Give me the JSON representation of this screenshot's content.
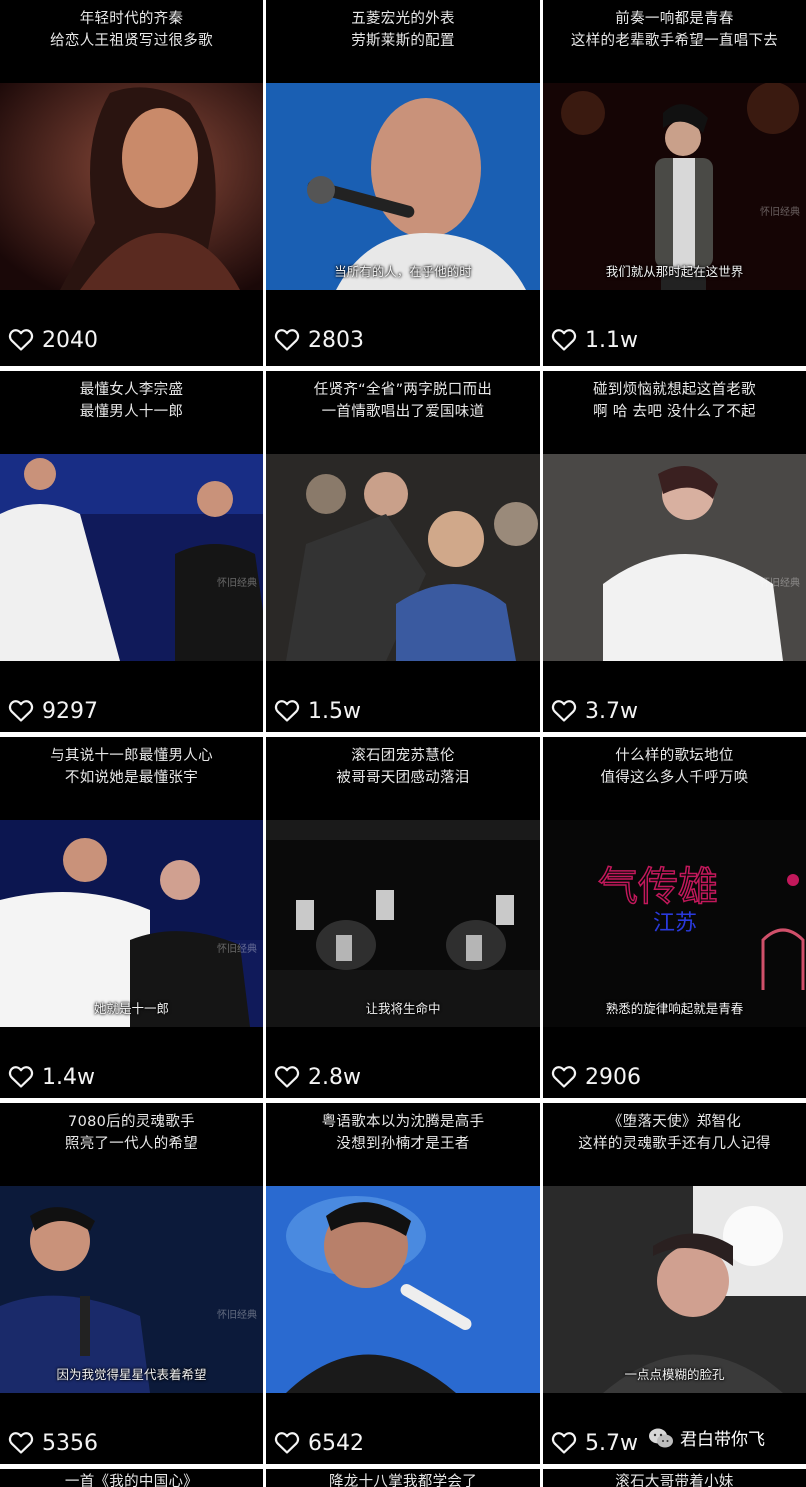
{
  "colors": {
    "cell_bg": "#000000",
    "gap": "#ffffff",
    "text": "#e8e8e8"
  },
  "icons": {
    "like": "heart-outline-icon",
    "account": "wechat-icon"
  },
  "cells": [
    {
      "caption": [
        "年轻时代的齐秦",
        "给恋人王祖贤写过很多歌"
      ],
      "subtitle": "",
      "watermark": "",
      "likes": "2040"
    },
    {
      "caption": [
        "五菱宏光的外表",
        "劳斯莱斯的配置"
      ],
      "subtitle": "当所有的人，在乎他的时",
      "watermark": "",
      "likes": "2803"
    },
    {
      "caption": [
        "前奏一响都是青春",
        "这样的老辈歌手希望一直唱下去"
      ],
      "subtitle": "我们就从那时起在这世界",
      "watermark": "怀旧经典",
      "likes": "1.1w"
    },
    {
      "caption": [
        "最懂女人李宗盛",
        "最懂男人十一郎"
      ],
      "subtitle": "",
      "watermark": "怀旧经典",
      "likes": "9297"
    },
    {
      "caption": [
        "任贤齐“全省”两字脱口而出",
        "一首情歌唱出了爱国味道"
      ],
      "subtitle": "",
      "watermark": "",
      "likes": "1.5w"
    },
    {
      "caption": [
        "碰到烦恼就想起这首老歌",
        "啊 哈 去吧 没什么了不起"
      ],
      "subtitle": "",
      "watermark": "怀旧经典",
      "likes": "3.7w"
    },
    {
      "caption": [
        "与其说十一郎最懂男人心",
        "不如说她是最懂张宇"
      ],
      "subtitle": "她就是十一郎",
      "watermark": "怀旧经典",
      "likes": "1.4w"
    },
    {
      "caption": [
        "滚石团宠苏慧伦",
        "被哥哥天团感动落泪"
      ],
      "subtitle": "让我将生命中",
      "watermark": "",
      "likes": "2.8w"
    },
    {
      "caption": [
        "什么样的歌坛地位",
        "值得这么多人千呼万唤"
      ],
      "subtitle": "熟悉的旋律响起就是青春",
      "watermark": "",
      "likes": "2906"
    },
    {
      "caption": [
        "7080后的灵魂歌手",
        "照亮了一代人的希望"
      ],
      "subtitle": "因为我觉得星星代表着希望",
      "watermark": "怀旧经典",
      "likes": "5356"
    },
    {
      "caption": [
        "粤语歌本以为沈腾是高手",
        "没想到孙楠才是王者"
      ],
      "subtitle": "",
      "watermark": "",
      "likes": "6542"
    },
    {
      "caption": [
        "《堕落天使》郑智化",
        "这样的灵魂歌手还有几人记得"
      ],
      "subtitle": "一点点模糊的脸孔",
      "watermark": "",
      "likes": "5.7w"
    },
    {
      "caption": [
        "一首《我的中国心》"
      ],
      "subtitle": "",
      "watermark": "",
      "likes": ""
    },
    {
      "caption": [
        "降龙十八掌我都学会了"
      ],
      "subtitle": "",
      "watermark": "",
      "likes": ""
    },
    {
      "caption": [
        "滚石大哥带着小妹"
      ],
      "subtitle": "",
      "watermark": "",
      "likes": ""
    }
  ],
  "sign_texts": {
    "neon": "气传雄",
    "neon2": "江苏"
  },
  "account": {
    "name": "君白带你飞"
  }
}
